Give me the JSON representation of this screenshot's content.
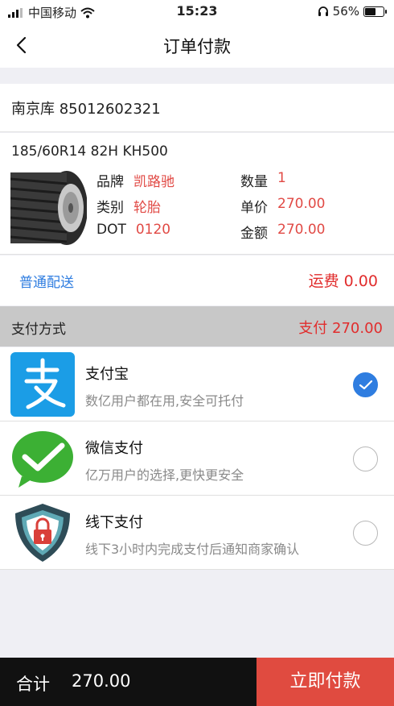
{
  "status_bar": {
    "carrier": "中国移动",
    "time": "15:23",
    "battery": "56%"
  },
  "nav": {
    "title": "订单付款"
  },
  "order": {
    "warehouse": "南京库 85012602321",
    "product_name": "185/60R14 82H KH500",
    "brand_label": "品牌",
    "brand": "凯路驰",
    "category_label": "类别",
    "category": "轮胎",
    "dot_label": "DOT",
    "dot": "0120",
    "quantity_label": "数量",
    "quantity": "1",
    "unit_price_label": "单价",
    "unit_price": "270.00",
    "amount_label": "金额",
    "amount": "270.00"
  },
  "delivery": {
    "mode": "普通配送",
    "shipping": "运费 0.00"
  },
  "payment": {
    "header_label": "支付方式",
    "header_amount": "支付 270.00",
    "methods": [
      {
        "title": "支付宝",
        "desc": "数亿用户都在用,安全可托付",
        "icon": "alipay-icon",
        "selected": true
      },
      {
        "title": "微信支付",
        "desc": "亿万用户的选择,更快更安全",
        "icon": "wechat-pay-icon",
        "selected": false
      },
      {
        "title": "线下支付",
        "desc": "线下3小时内完成支付后通知商家确认",
        "icon": "offline-shield-icon",
        "selected": false
      }
    ]
  },
  "footer": {
    "total_label": "合计",
    "total_amount": "270.00",
    "pay_button": "立即付款"
  },
  "colors": {
    "accent_red": "#e14a45",
    "link_blue": "#2f7de0",
    "pay_button": "#e04b40"
  }
}
